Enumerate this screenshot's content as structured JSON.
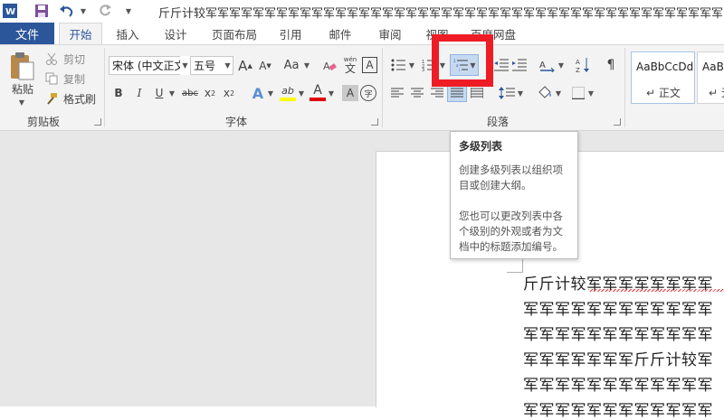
{
  "title_bar": {
    "document_title": "斤斤计较军军军军军军军军军军军军军军军军军军军军军军军军军军军军军军军军军军军军军军军军军军军军"
  },
  "tabs": {
    "file": "文件",
    "home": "开始",
    "insert": "插入",
    "design": "设计",
    "page_layout": "页面布局",
    "references": "引用",
    "mailings": "邮件",
    "review": "审阅",
    "view": "视图",
    "baidu_netdisk": "百度网盘"
  },
  "clipboard": {
    "paste": "粘贴",
    "cut": "剪切",
    "copy": "复制",
    "format_painter": "格式刷",
    "group_label": "剪贴板"
  },
  "font": {
    "font_name": "宋体 (中文正文",
    "font_size": "五号",
    "grow": "A",
    "shrink": "A",
    "change_case": "Aa",
    "phonetic_pinyin": "wén",
    "phonetic_char": "文",
    "char_border": "A",
    "bold": "B",
    "italic": "I",
    "underline": "U",
    "strikethrough": "abc",
    "subscript_base": "x",
    "subscript_mark": "2",
    "superscript_base": "x",
    "superscript_mark": "2",
    "text_effects": "A",
    "highlight": "ab",
    "font_color": "A",
    "char_shading": "A",
    "enclose": "字",
    "group_label": "字体"
  },
  "paragraph": {
    "group_label": "段落"
  },
  "styles": {
    "normal_preview": "AaBbCcDd",
    "normal_label": "正文",
    "no_spacing_preview": "AaBb",
    "no_spacing_label": "无"
  },
  "tooltip": {
    "title": "多级列表",
    "line1": "创建多级列表以组织项",
    "line2": "目或创建大纲。",
    "line3": "您也可以更改列表中各",
    "line4": "个级别的外观或者为文",
    "line5": "档中的标题添加编号。"
  },
  "document": {
    "lines": [
      "斤斤计较军军军军军军军军",
      "军军军军军军军军军军军军",
      "军军军军军军军军军军军军",
      "军军军军军军军斤斤计较军",
      "军军军军军军军军军军军军",
      "军军军军军军军军军军军军"
    ]
  },
  "colors": {
    "file_tab": "#2b579a",
    "highlight_frame": "#ee1c24",
    "font_color_bar": "#e00000",
    "highlight_color_bar": "#ffff00"
  }
}
